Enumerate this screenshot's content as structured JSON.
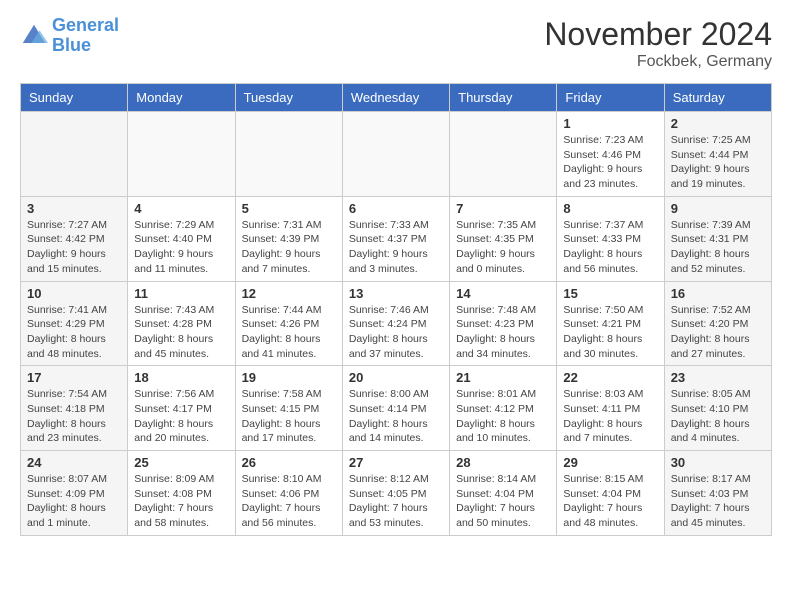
{
  "header": {
    "logo_line1": "General",
    "logo_line2": "Blue",
    "month_title": "November 2024",
    "location": "Fockbek, Germany"
  },
  "days_of_week": [
    "Sunday",
    "Monday",
    "Tuesday",
    "Wednesday",
    "Thursday",
    "Friday",
    "Saturday"
  ],
  "weeks": [
    [
      {
        "day": "",
        "info": ""
      },
      {
        "day": "",
        "info": ""
      },
      {
        "day": "",
        "info": ""
      },
      {
        "day": "",
        "info": ""
      },
      {
        "day": "",
        "info": ""
      },
      {
        "day": "1",
        "info": "Sunrise: 7:23 AM\nSunset: 4:46 PM\nDaylight: 9 hours\nand 23 minutes."
      },
      {
        "day": "2",
        "info": "Sunrise: 7:25 AM\nSunset: 4:44 PM\nDaylight: 9 hours\nand 19 minutes."
      }
    ],
    [
      {
        "day": "3",
        "info": "Sunrise: 7:27 AM\nSunset: 4:42 PM\nDaylight: 9 hours\nand 15 minutes."
      },
      {
        "day": "4",
        "info": "Sunrise: 7:29 AM\nSunset: 4:40 PM\nDaylight: 9 hours\nand 11 minutes."
      },
      {
        "day": "5",
        "info": "Sunrise: 7:31 AM\nSunset: 4:39 PM\nDaylight: 9 hours\nand 7 minutes."
      },
      {
        "day": "6",
        "info": "Sunrise: 7:33 AM\nSunset: 4:37 PM\nDaylight: 9 hours\nand 3 minutes."
      },
      {
        "day": "7",
        "info": "Sunrise: 7:35 AM\nSunset: 4:35 PM\nDaylight: 9 hours\nand 0 minutes."
      },
      {
        "day": "8",
        "info": "Sunrise: 7:37 AM\nSunset: 4:33 PM\nDaylight: 8 hours\nand 56 minutes."
      },
      {
        "day": "9",
        "info": "Sunrise: 7:39 AM\nSunset: 4:31 PM\nDaylight: 8 hours\nand 52 minutes."
      }
    ],
    [
      {
        "day": "10",
        "info": "Sunrise: 7:41 AM\nSunset: 4:29 PM\nDaylight: 8 hours\nand 48 minutes."
      },
      {
        "day": "11",
        "info": "Sunrise: 7:43 AM\nSunset: 4:28 PM\nDaylight: 8 hours\nand 45 minutes."
      },
      {
        "day": "12",
        "info": "Sunrise: 7:44 AM\nSunset: 4:26 PM\nDaylight: 8 hours\nand 41 minutes."
      },
      {
        "day": "13",
        "info": "Sunrise: 7:46 AM\nSunset: 4:24 PM\nDaylight: 8 hours\nand 37 minutes."
      },
      {
        "day": "14",
        "info": "Sunrise: 7:48 AM\nSunset: 4:23 PM\nDaylight: 8 hours\nand 34 minutes."
      },
      {
        "day": "15",
        "info": "Sunrise: 7:50 AM\nSunset: 4:21 PM\nDaylight: 8 hours\nand 30 minutes."
      },
      {
        "day": "16",
        "info": "Sunrise: 7:52 AM\nSunset: 4:20 PM\nDaylight: 8 hours\nand 27 minutes."
      }
    ],
    [
      {
        "day": "17",
        "info": "Sunrise: 7:54 AM\nSunset: 4:18 PM\nDaylight: 8 hours\nand 23 minutes."
      },
      {
        "day": "18",
        "info": "Sunrise: 7:56 AM\nSunset: 4:17 PM\nDaylight: 8 hours\nand 20 minutes."
      },
      {
        "day": "19",
        "info": "Sunrise: 7:58 AM\nSunset: 4:15 PM\nDaylight: 8 hours\nand 17 minutes."
      },
      {
        "day": "20",
        "info": "Sunrise: 8:00 AM\nSunset: 4:14 PM\nDaylight: 8 hours\nand 14 minutes."
      },
      {
        "day": "21",
        "info": "Sunrise: 8:01 AM\nSunset: 4:12 PM\nDaylight: 8 hours\nand 10 minutes."
      },
      {
        "day": "22",
        "info": "Sunrise: 8:03 AM\nSunset: 4:11 PM\nDaylight: 8 hours\nand 7 minutes."
      },
      {
        "day": "23",
        "info": "Sunrise: 8:05 AM\nSunset: 4:10 PM\nDaylight: 8 hours\nand 4 minutes."
      }
    ],
    [
      {
        "day": "24",
        "info": "Sunrise: 8:07 AM\nSunset: 4:09 PM\nDaylight: 8 hours\nand 1 minute."
      },
      {
        "day": "25",
        "info": "Sunrise: 8:09 AM\nSunset: 4:08 PM\nDaylight: 7 hours\nand 58 minutes."
      },
      {
        "day": "26",
        "info": "Sunrise: 8:10 AM\nSunset: 4:06 PM\nDaylight: 7 hours\nand 56 minutes."
      },
      {
        "day": "27",
        "info": "Sunrise: 8:12 AM\nSunset: 4:05 PM\nDaylight: 7 hours\nand 53 minutes."
      },
      {
        "day": "28",
        "info": "Sunrise: 8:14 AM\nSunset: 4:04 PM\nDaylight: 7 hours\nand 50 minutes."
      },
      {
        "day": "29",
        "info": "Sunrise: 8:15 AM\nSunset: 4:04 PM\nDaylight: 7 hours\nand 48 minutes."
      },
      {
        "day": "30",
        "info": "Sunrise: 8:17 AM\nSunset: 4:03 PM\nDaylight: 7 hours\nand 45 minutes."
      }
    ]
  ]
}
